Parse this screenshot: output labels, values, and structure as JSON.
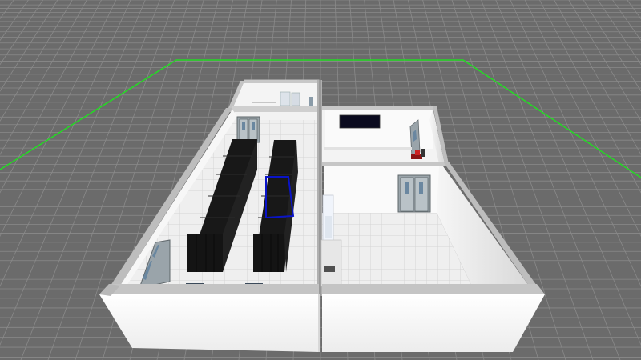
{
  "scene": {
    "view": "3d-isometric",
    "background_color": "#6b6b6b",
    "grid_line_color": "#8a8a8a",
    "boundary_color": "#22dd22",
    "wall_color": "#ffffff",
    "floor_color": "#eeeeee",
    "rack_color": "#1c1c1c",
    "selection_color": "#0a14c8"
  },
  "objects": {
    "rack_rows": 2,
    "selected_object": "server-rack"
  }
}
